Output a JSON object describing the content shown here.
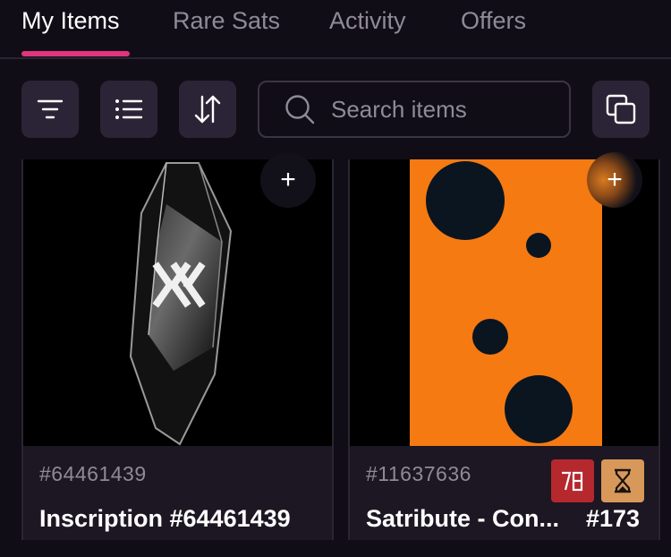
{
  "tabs": [
    {
      "label": "My Items",
      "active": true
    },
    {
      "label": "Rare Sats",
      "active": false
    },
    {
      "label": "Activity",
      "active": false
    },
    {
      "label": "Offers",
      "active": false
    }
  ],
  "toolbar": {
    "filter_icon": "filter-icon",
    "list_icon": "list-view-icon",
    "sort_icon": "sort-icon",
    "copy_icon": "copy-icon"
  },
  "search": {
    "placeholder": "Search items",
    "value": ""
  },
  "items": [
    {
      "id_label": "#64461439",
      "name": "Inscription #64461439",
      "add_label": "+"
    },
    {
      "id_label": "#11637636",
      "name": "Satribute - Con...",
      "number": "#173",
      "add_label": "+",
      "badges": [
        "satribute-78-icon",
        "hourglass-icon"
      ]
    }
  ],
  "colors": {
    "accent": "#e0357d",
    "background": "#110d16",
    "card": "#1c1722",
    "orange": "#f57a12",
    "dot": "#0b1520",
    "badge_red": "#b5282e",
    "badge_tan": "#d8985a"
  }
}
